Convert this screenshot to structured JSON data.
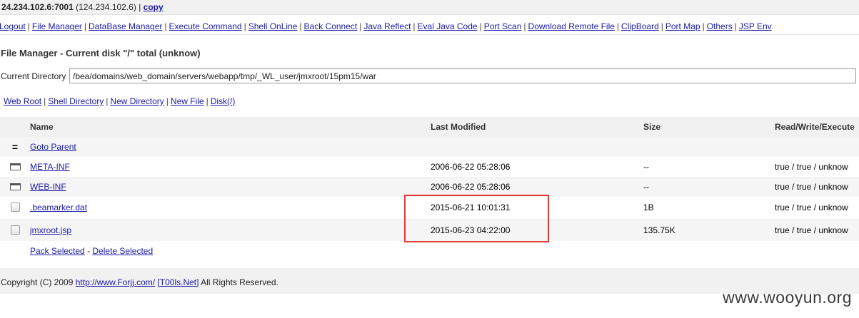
{
  "topbar": {
    "host": "24.234.102.6:7001",
    "ip": "(124.234.102.6)",
    "separator": "|",
    "copy_label": "copy"
  },
  "menu": [
    {
      "label": "Logout",
      "name": "menu-logout"
    },
    {
      "label": "File Manager",
      "name": "menu-file-manager"
    },
    {
      "label": "DataBase Manager",
      "name": "menu-database-manager"
    },
    {
      "label": "Execute Command",
      "name": "menu-execute-command"
    },
    {
      "label": "Shell OnLine",
      "name": "menu-shell-online"
    },
    {
      "label": "Back Connect",
      "name": "menu-back-connect"
    },
    {
      "label": "Java Reflect",
      "name": "menu-java-reflect"
    },
    {
      "label": "Eval Java Code",
      "name": "menu-eval-java-code"
    },
    {
      "label": "Port Scan",
      "name": "menu-port-scan"
    },
    {
      "label": "Download Remote File",
      "name": "menu-download-remote-file"
    },
    {
      "label": "ClipBoard",
      "name": "menu-clipboard"
    },
    {
      "label": "Port Map",
      "name": "menu-port-map"
    },
    {
      "label": "Others",
      "name": "menu-others"
    },
    {
      "label": "JSP Env",
      "name": "menu-jsp-env"
    }
  ],
  "file_manager": {
    "title": "File Manager - Current disk \"/\" total (unknow)",
    "current_dir_label": "Current Directory",
    "current_dir_value": "/bea/domains/web_domain/servers/webapp/tmp/_WL_user/jmxroot/15pm15/war"
  },
  "quick_links": [
    {
      "label": "Web Root",
      "name": "link-web-root"
    },
    {
      "label": "Shell Directory",
      "name": "link-shell-directory"
    },
    {
      "label": "New Directory",
      "name": "link-new-directory"
    },
    {
      "label": "New File",
      "name": "link-new-file"
    },
    {
      "label": "Disk(/)",
      "name": "link-disk-root"
    }
  ],
  "table": {
    "headers": {
      "name": "Name",
      "modified": "Last Modified",
      "size": "Size",
      "rwe": "Read/Write/Execute"
    },
    "parent": {
      "icon": "=",
      "label": "Goto Parent"
    },
    "rows": [
      {
        "type": "folder",
        "name": "META-INF",
        "modified": "2006-06-22 05:28:06",
        "size": "--",
        "rwe": "true / true / unknow"
      },
      {
        "type": "folder",
        "name": "WEB-INF",
        "modified": "2006-06-22 05:28:06",
        "size": "--",
        "rwe": "true / true / unknow"
      },
      {
        "type": "file",
        "name": ".beamarker.dat",
        "modified": "2015-06-21 10:01:31",
        "size": "1B",
        "rwe": "true / true / unknow"
      },
      {
        "type": "file",
        "name": "jmxroot.jsp",
        "modified": "2015-06-23 04:22:00",
        "size": "135.75K",
        "rwe": "true / true / unknow"
      }
    ],
    "actions": {
      "pack": "Pack Selected",
      "dash": "-",
      "delete": "Delete Selected"
    }
  },
  "footer": {
    "copyright_prefix": "Copyright (C) 2009",
    "site1": "http://www.Forjj.com/",
    "site2": "[T00ls.Net]",
    "suffix": "All Rights Reserved."
  },
  "watermark": "www.wooyun.org",
  "colors": {
    "link": "#1a1aa6",
    "highlight_box": "#e53a3a",
    "header_bg": "#f1f1f1"
  }
}
